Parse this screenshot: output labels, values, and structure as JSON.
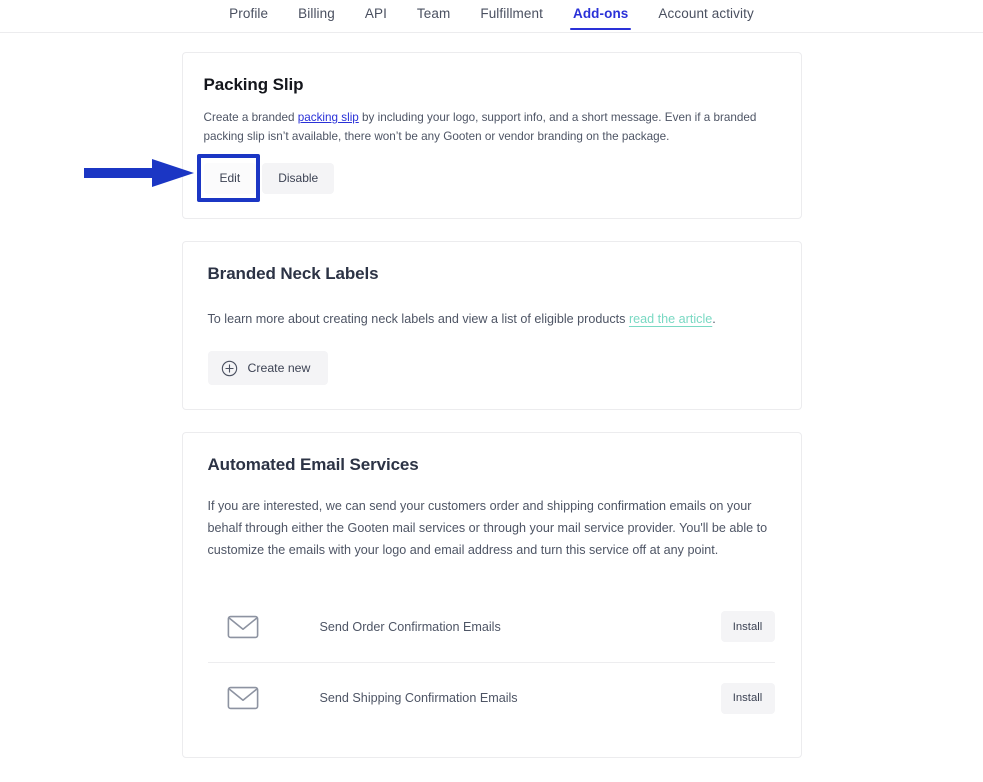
{
  "tabs": [
    {
      "label": "Profile",
      "active": false
    },
    {
      "label": "Billing",
      "active": false
    },
    {
      "label": "API",
      "active": false
    },
    {
      "label": "Team",
      "active": false
    },
    {
      "label": "Fulfillment",
      "active": false
    },
    {
      "label": "Add-ons",
      "active": true
    },
    {
      "label": "Account activity",
      "active": false
    }
  ],
  "colors": {
    "accent_blue": "#2a31d8",
    "annotation_blue": "#1b36c4",
    "link_teal": "#7ad9c3",
    "heading_dark": "#14161c",
    "body_text": "#4e5565",
    "button_bg": "#f4f4f6",
    "card_border": "#ececee"
  },
  "packing_slip": {
    "title": "Packing Slip",
    "desc_part1": "Create a branded ",
    "desc_link": "packing slip",
    "desc_part2": " by including your logo, support info, and a short message. Even if a branded packing slip isn’t available, there won’t be any Gooten or vendor branding on the package.",
    "edit_label": "Edit",
    "disable_label": "Disable"
  },
  "neck_labels": {
    "title": "Branded Neck Labels",
    "desc_part1": "To learn more about creating neck labels and view a list of eligible products ",
    "desc_link": "read the article",
    "desc_part2": ".",
    "create_label": "Create new",
    "create_icon": "circle-plus-icon"
  },
  "email_services": {
    "title": "Automated Email Services",
    "desc": "If you are interested, we can send your customers order and shipping confirmation emails on your behalf through either the Gooten mail services or through your mail service provider. You'll be able to customize the emails with your logo and email address and turn this service off at any point.",
    "rows": [
      {
        "icon": "envelope-icon",
        "label": "Send Order Confirmation Emails",
        "action": "Install"
      },
      {
        "icon": "envelope-icon",
        "label": "Send Shipping Confirmation Emails",
        "action": "Install"
      }
    ]
  },
  "annotation": {
    "arrow_icon": "right-arrow-annotation",
    "target": "Edit"
  }
}
